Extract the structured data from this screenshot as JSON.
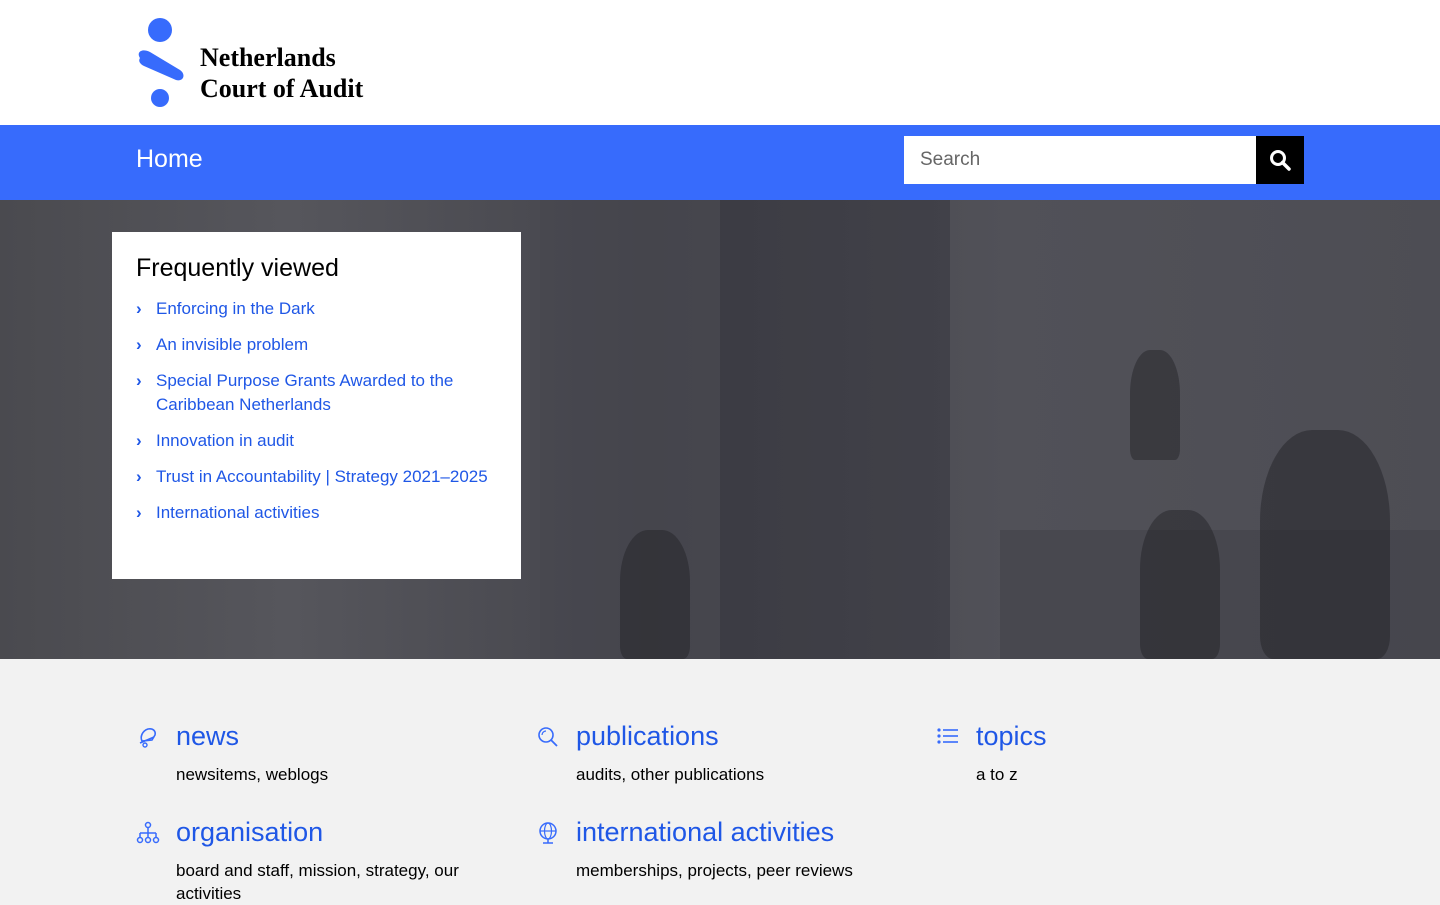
{
  "header": {
    "logo_line1": "Netherlands",
    "logo_line2": "Court of Audit"
  },
  "nav": {
    "home_label": "Home",
    "search_placeholder": "Search"
  },
  "frequently_viewed": {
    "title": "Frequently viewed",
    "items": [
      {
        "label": "Enforcing in the Dark"
      },
      {
        "label": "An invisible problem"
      },
      {
        "label": "Special Purpose Grants Awarded to the Caribbean Netherlands"
      },
      {
        "label": "Innovation in audit"
      },
      {
        "label": "Trust in Accountability | Strategy 2021–2025"
      },
      {
        "label": "International activities"
      }
    ]
  },
  "categories": [
    {
      "title": "news",
      "subtitle": "newsitems, weblogs",
      "icon": "bell-icon"
    },
    {
      "title": "publications",
      "subtitle": "audits, other publications",
      "icon": "magnifier-icon"
    },
    {
      "title": "topics",
      "subtitle": "a to z",
      "icon": "list-icon"
    },
    {
      "title": "organisation",
      "subtitle": "board and staff, mission, strategy, our activities",
      "icon": "org-chart-icon"
    },
    {
      "title": "international activities",
      "subtitle": "memberships, projects, peer reviews",
      "icon": "globe-icon"
    }
  ],
  "colors": {
    "brand_blue": "#376bfc",
    "link_blue": "#1f57e6"
  }
}
